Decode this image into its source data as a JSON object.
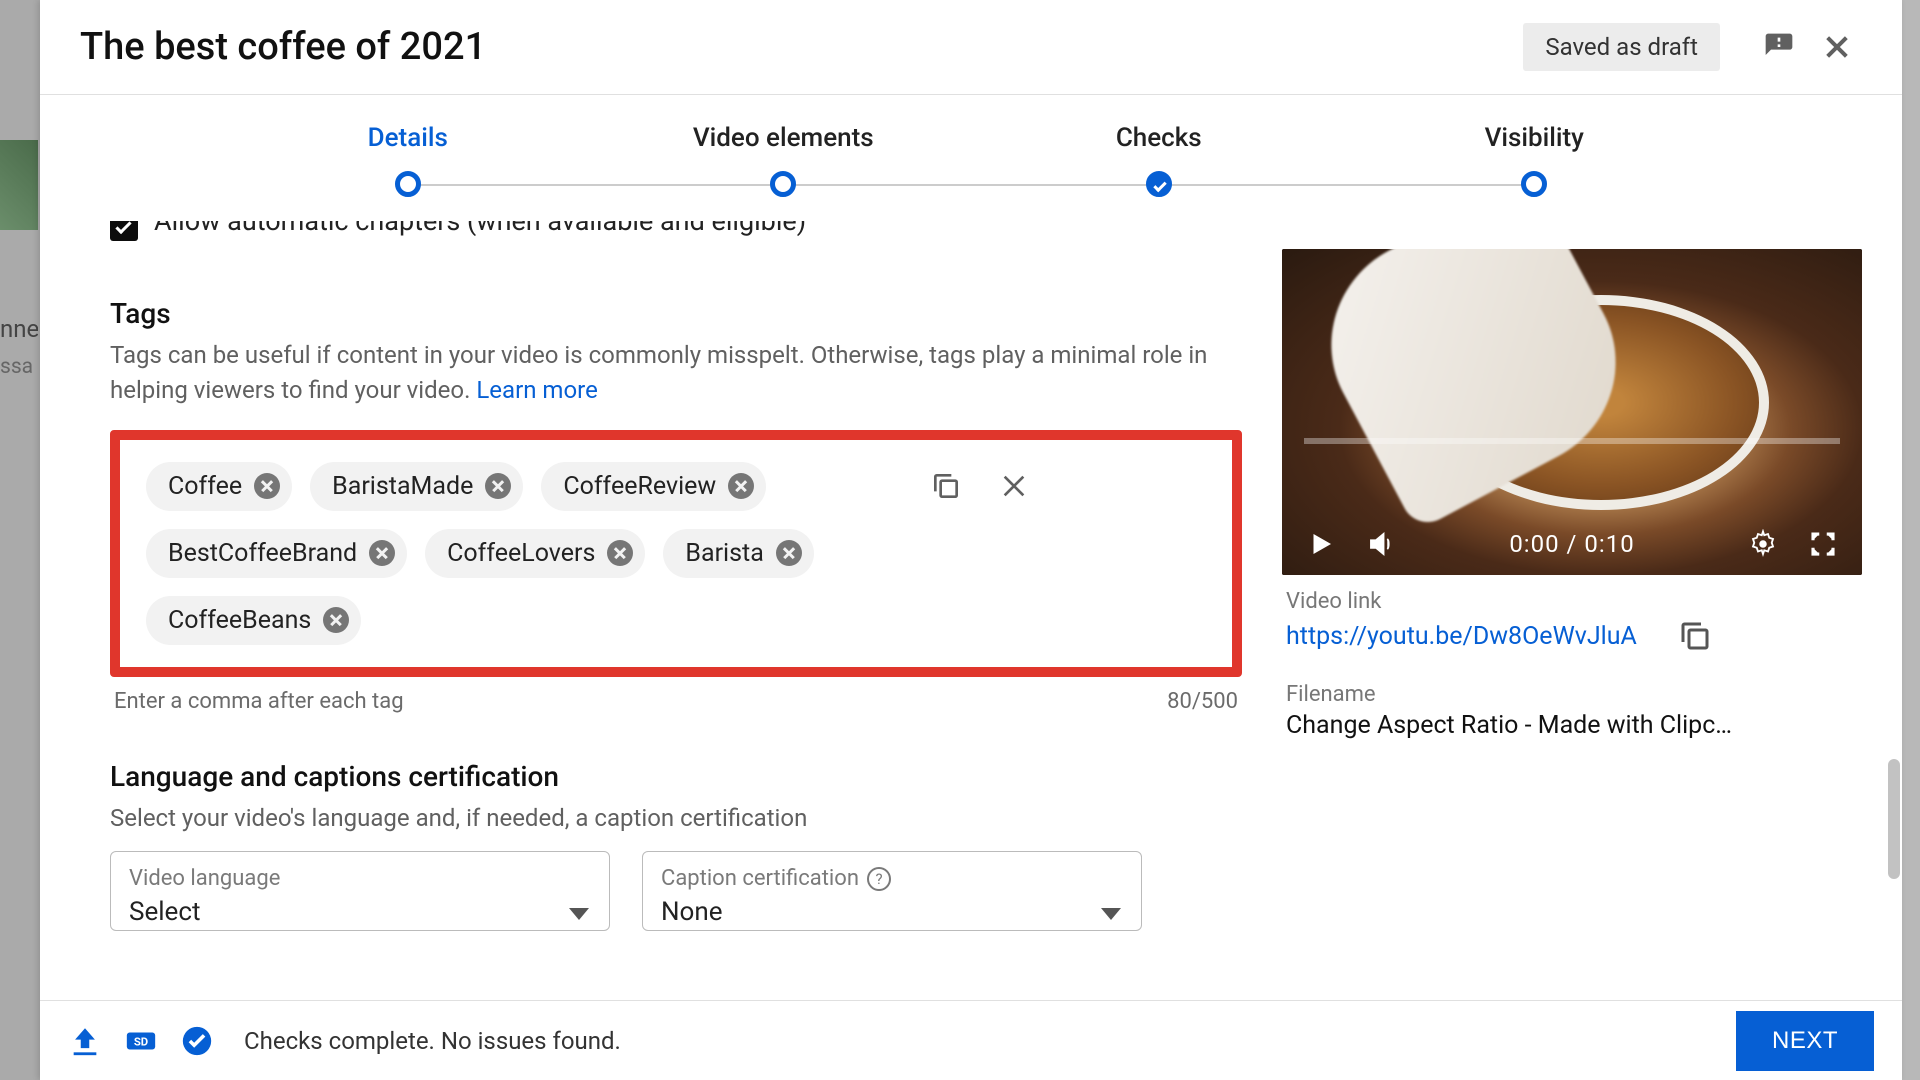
{
  "header": {
    "title": "The best coffee of 2021",
    "saved_label": "Saved as draft"
  },
  "stepper": {
    "steps": [
      {
        "label": "Details",
        "state": "active"
      },
      {
        "label": "Video elements",
        "state": "pending"
      },
      {
        "label": "Checks",
        "state": "done"
      },
      {
        "label": "Visibility",
        "state": "pending"
      }
    ]
  },
  "cutoff": {
    "text": "Allow automatic chapters (when available and eligible)"
  },
  "tags_section": {
    "heading": "Tags",
    "description": "Tags can be useful if content in your video is commonly misspelt. Otherwise, tags play a minimal role in helping viewers to find your video. ",
    "learn_more": "Learn more",
    "tags": [
      "Coffee",
      "BaristaMade",
      "CoffeeReview",
      "BestCoffeeBrand",
      "CoffeeLovers",
      "Barista",
      "CoffeeBeans"
    ],
    "hint": "Enter a comma after each tag",
    "counter": "80/500"
  },
  "lang_section": {
    "heading": "Language and captions certification",
    "description": "Select your video's language and, if needed, a caption certification",
    "video_lang_label": "Video language",
    "video_lang_value": "Select",
    "caption_label": "Caption certification",
    "caption_value": "None"
  },
  "preview": {
    "time": "0:00 / 0:10",
    "link_label": "Video link",
    "link": "https://youtu.be/Dw8OeWvJluA",
    "filename_label": "Filename",
    "filename": "Change Aspect Ratio - Made with Clipc…"
  },
  "footer": {
    "status": "Checks complete. No issues found.",
    "next": "NEXT"
  }
}
